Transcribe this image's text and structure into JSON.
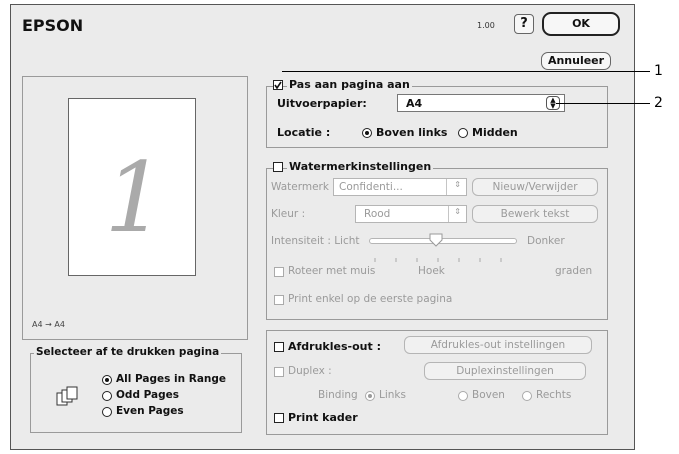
{
  "title": "EPSON",
  "version": "1.00",
  "help_label": "?",
  "ok_label": "OK",
  "cancel_label": "Annuleer",
  "preview": {
    "page_number": "1",
    "paper_label": "A4 → A4"
  },
  "fit": {
    "checkbox_label": "Pas aan pagina aan",
    "checked": true,
    "output_paper_label": "Uitvoerpapier:",
    "output_paper_value": "A4",
    "location_label": "Locatie :",
    "location_options": [
      "Boven links",
      "Midden"
    ],
    "location_selected": "Boven links"
  },
  "watermark": {
    "checkbox_label": "Watermerkinstellingen",
    "watermark_label": "Watermerk :",
    "watermark_value": "Confidenti...",
    "new_delete_label": "Nieuw/Verwijder",
    "color_label": "Kleur :",
    "color_value": "Rood",
    "edit_text_label": "Bewerk tekst",
    "intensity_label": "Intensiteit : Licht",
    "intensity_dark_label": "Donker",
    "intensity_level": 0.45,
    "rotate_label": "Roteer met muis",
    "angle_label": "Hoek",
    "degrees_label": "graden",
    "first_page_label": "Print enkel op de eerste pagina"
  },
  "print_range": {
    "title": "Selecteer af te drukken pagina",
    "options": [
      "All Pages in Range",
      "Odd Pages",
      "Even Pages"
    ],
    "selected": "All Pages in Range"
  },
  "layout": {
    "checkbox_label": "Afdrukles-out :",
    "settings_button": "Afdrukles-out instellingen"
  },
  "duplex": {
    "checkbox_label": "Duplex :",
    "settings_button": "Duplexinstellingen",
    "binding_label": "Binding",
    "binding_options": [
      "Links",
      "Boven",
      "Rechts"
    ],
    "binding_selected": "Links"
  },
  "frame": {
    "checkbox_label": "Print kader"
  },
  "callouts": [
    "1",
    "2"
  ]
}
